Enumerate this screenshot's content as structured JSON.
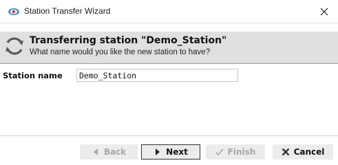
{
  "window": {
    "title": "Station Transfer Wizard",
    "app_icon": "station-icon",
    "close_icon": "close-icon"
  },
  "header": {
    "icon": "refresh-icon",
    "title": "Transferring station \"Demo_Station\"",
    "subtitle": "What name would you like the new station to have?"
  },
  "form": {
    "station_name_label": "Station name",
    "station_name_value": "Demo_Station"
  },
  "buttons": {
    "back": {
      "label": "Back",
      "icon": "left-triangle-icon",
      "enabled": false
    },
    "next": {
      "label": "Next",
      "icon": "right-triangle-icon",
      "enabled": true
    },
    "finish": {
      "label": "Finish",
      "icon": "check-icon",
      "enabled": false
    },
    "cancel": {
      "label": "Cancel",
      "icon": "x-icon",
      "enabled": true
    }
  }
}
